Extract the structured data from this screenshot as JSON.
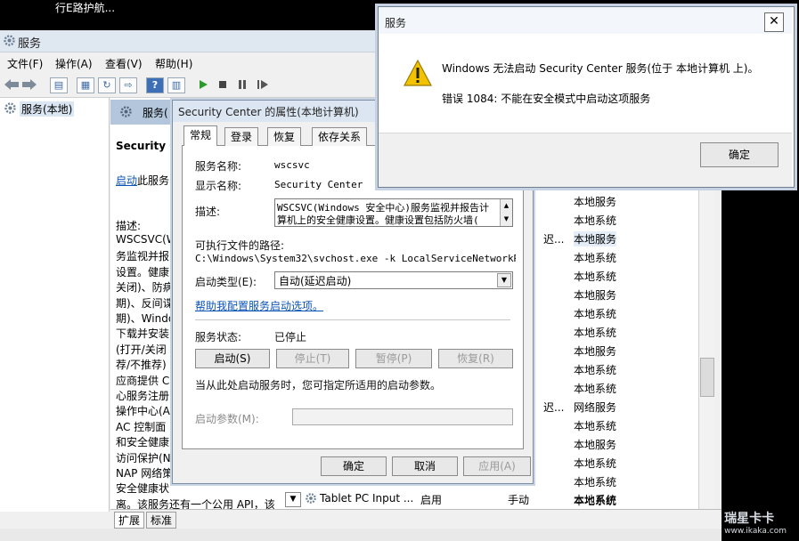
{
  "top_strip_text": "行E路护航...",
  "main_window": {
    "title": "服务",
    "menu": [
      "文件(F)",
      "操作(A)",
      "查看(V)",
      "帮助(H)"
    ],
    "left_tree_item": "服务(本地)",
    "pane_header": "服务(",
    "selected_service_name": "Security C",
    "start_link": "启动",
    "start_link_rest": "此服务",
    "description_label": "描述:",
    "description_lines": [
      "WSCSVC(W",
      "务监视并报",
      "设置。健康",
      "关闭)、防病",
      "期)、反间谍",
      "期)、Windo",
      "下载并安装",
      "(打开/关闭",
      "荐/不推荐)",
      "应商提供 C",
      "心服务注册",
      "操作中心(A",
      "AC 控制面",
      "和安全健康",
      "访问保护(N",
      "NAP 网络策",
      "安全健康状",
      "离。该服务还有一个公用 API，该"
    ],
    "service_rows": [
      {
        "login": "本地服务",
        "delay": ""
      },
      {
        "login": "本地系统",
        "delay": ""
      },
      {
        "login": "本地服务",
        "delay": "迟..."
      },
      {
        "login": "本地系统",
        "delay": ""
      },
      {
        "login": "本地系统",
        "delay": ""
      },
      {
        "login": "本地服务",
        "delay": ""
      },
      {
        "login": "本地系统",
        "delay": ""
      },
      {
        "login": "本地系统",
        "delay": ""
      },
      {
        "login": "本地服务",
        "delay": ""
      },
      {
        "login": "本地系统",
        "delay": ""
      },
      {
        "login": "本地系统",
        "delay": ""
      },
      {
        "login": "网络服务",
        "delay": "迟..."
      },
      {
        "login": "本地系统",
        "delay": ""
      },
      {
        "login": "本地服务",
        "delay": ""
      },
      {
        "login": "本地系统",
        "delay": ""
      },
      {
        "login": "本地系统",
        "delay": ""
      },
      {
        "login": "本地系统",
        "delay": ""
      },
      {
        "login": "本地系统",
        "delay": ""
      }
    ],
    "last_row": {
      "name": "Tablet PC Input ...",
      "status": "启用",
      "startup": "手动",
      "login": "本地系统"
    },
    "tabs": [
      "扩展",
      "标准"
    ]
  },
  "properties_dialog": {
    "title": "Security Center 的属性(本地计算机)",
    "tabs": [
      "常规",
      "登录",
      "恢复",
      "依存关系"
    ],
    "service_name_label": "服务名称:",
    "service_name_value": "wscsvc",
    "display_name_label": "显示名称:",
    "display_name_value": "Security Center",
    "description_label": "描述:",
    "description_line1": "WSCSVC(Windows 安全中心)服务监视并报告计",
    "description_line2": "算机上的安全健康设置。健康设置包括防火墙(",
    "exe_path_label": "可执行文件的路径:",
    "exe_path_value": "C:\\Windows\\System32\\svchost.exe -k LocalServiceNetworkRestri",
    "startup_type_label": "启动类型(E):",
    "startup_type_value": "自动(延迟启动)",
    "help_link": "帮助我配置服务启动选项。",
    "status_label": "服务状态:",
    "status_value": "已停止",
    "btn_start": "启动(S)",
    "btn_stop": "停止(T)",
    "btn_pause": "暂停(P)",
    "btn_resume": "恢复(R)",
    "hint": "当从此处启动服务时，您可指定所适用的启动参数。",
    "start_params_label": "启动参数(M):",
    "btn_ok": "确定",
    "btn_cancel": "取消",
    "btn_apply": "应用(A)"
  },
  "error_dialog": {
    "title": "服务",
    "message": "Windows 无法启动 Security Center 服务(位于 本地计算机 上)。",
    "detail": "错误 1084: 不能在安全模式中启动这项服务",
    "ok": "确定",
    "close_glyph": "✕"
  },
  "watermark": {
    "line1": "瑞星卡卡",
    "line2": "www.ikaka.com"
  },
  "colors": {
    "link": "#0b53b6",
    "warning": "#f2c200",
    "titlebar": "#dfe7f1"
  }
}
